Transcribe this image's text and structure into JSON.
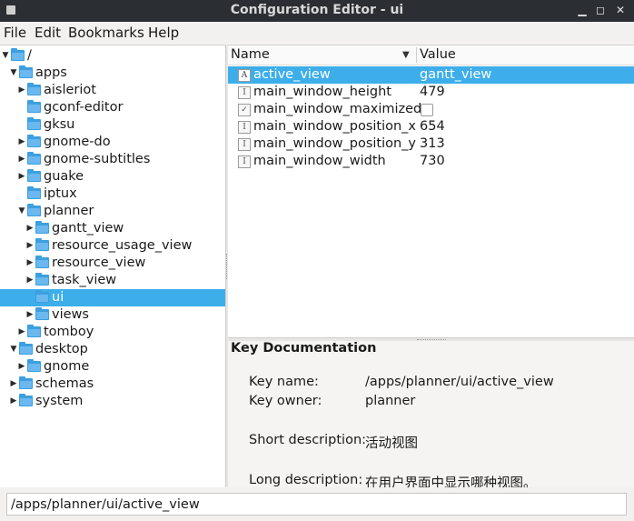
{
  "window": {
    "title": "Configuration Editor - ui"
  },
  "menu": [
    "File",
    "Edit",
    "Bookmarks",
    "Help"
  ],
  "tree": [
    {
      "label": "/",
      "depth": 0,
      "expander": "expanded"
    },
    {
      "label": "apps",
      "depth": 1,
      "expander": "expanded"
    },
    {
      "label": "aisleriot",
      "depth": 2,
      "expander": "collapsed"
    },
    {
      "label": "gconf-editor",
      "depth": 2,
      "expander": "none"
    },
    {
      "label": "gksu",
      "depth": 2,
      "expander": "none"
    },
    {
      "label": "gnome-do",
      "depth": 2,
      "expander": "collapsed"
    },
    {
      "label": "gnome-subtitles",
      "depth": 2,
      "expander": "collapsed"
    },
    {
      "label": "guake",
      "depth": 2,
      "expander": "collapsed"
    },
    {
      "label": "iptux",
      "depth": 2,
      "expander": "none"
    },
    {
      "label": "planner",
      "depth": 2,
      "expander": "expanded"
    },
    {
      "label": "gantt_view",
      "depth": 3,
      "expander": "collapsed"
    },
    {
      "label": "resource_usage_view",
      "depth": 3,
      "expander": "collapsed"
    },
    {
      "label": "resource_view",
      "depth": 3,
      "expander": "collapsed"
    },
    {
      "label": "task_view",
      "depth": 3,
      "expander": "collapsed"
    },
    {
      "label": "ui",
      "depth": 3,
      "expander": "none",
      "selected": true
    },
    {
      "label": "views",
      "depth": 3,
      "expander": "collapsed"
    },
    {
      "label": "tomboy",
      "depth": 2,
      "expander": "collapsed"
    },
    {
      "label": "desktop",
      "depth": 1,
      "expander": "expanded"
    },
    {
      "label": "gnome",
      "depth": 2,
      "expander": "collapsed"
    },
    {
      "label": "schemas",
      "depth": 1,
      "expander": "collapsed"
    },
    {
      "label": "system",
      "depth": 1,
      "expander": "collapsed"
    }
  ],
  "keylist": {
    "headers": {
      "name": "Name",
      "value": "Value"
    },
    "rows": [
      {
        "type": "A",
        "name": "active_view",
        "value": "gantt_view",
        "selected": true
      },
      {
        "type": "I",
        "name": "main_window_height",
        "value": "479"
      },
      {
        "type": "✓",
        "name": "main_window_maximized",
        "value": "",
        "checkbox": false
      },
      {
        "type": "I",
        "name": "main_window_position_x",
        "value": "654"
      },
      {
        "type": "I",
        "name": "main_window_position_y",
        "value": "313"
      },
      {
        "type": "I",
        "name": "main_window_width",
        "value": "730"
      }
    ]
  },
  "docs": {
    "title": "Key Documentation",
    "key_name_label": "Key name:",
    "key_name": "/apps/planner/ui/active_view",
    "key_owner_label": "Key owner:",
    "key_owner": "planner",
    "short_label": "Short description:",
    "short": "活动视图",
    "long_label": "Long description:",
    "long": "在用户界面中显示哪种视图。"
  },
  "path": "/apps/planner/ui/active_view",
  "colors": {
    "selection": "#3daee9",
    "folder": "#3c9fe0",
    "titlebar": "#2b2e33"
  }
}
